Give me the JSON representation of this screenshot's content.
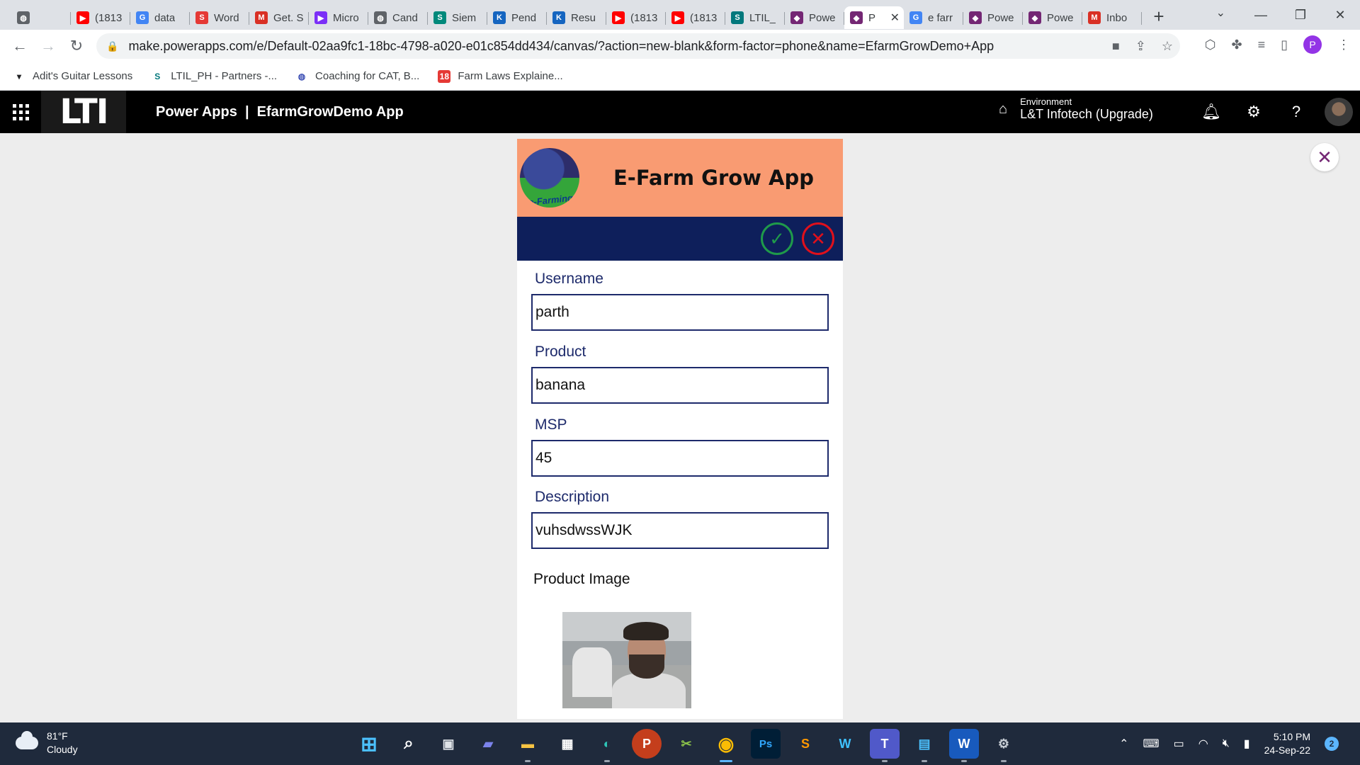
{
  "browser": {
    "tabs": [
      {
        "label": "",
        "icon": "globe-icon",
        "color": "#5f6368"
      },
      {
        "label": "(1813",
        "icon": "youtube-icon",
        "color": "#ff0000"
      },
      {
        "label": "data",
        "icon": "google-icon",
        "color": "#4285f4"
      },
      {
        "label": "Word",
        "icon": "s-logo-icon",
        "color": "#e53935"
      },
      {
        "label": "Get. S",
        "icon": "gmail-icon",
        "color": "#d93025"
      },
      {
        "label": "Micro",
        "icon": "arrow-logo-icon",
        "color": "#7b2ff7"
      },
      {
        "label": "Cand",
        "icon": "globe-icon",
        "color": "#5f6368"
      },
      {
        "label": "Siem",
        "icon": "s-logo-icon",
        "color": "#00897b"
      },
      {
        "label": "Pend",
        "icon": "k-logo-icon",
        "color": "#1565c0"
      },
      {
        "label": "Resu",
        "icon": "k-logo-icon",
        "color": "#1565c0"
      },
      {
        "label": "(1813",
        "icon": "youtube-icon",
        "color": "#ff0000"
      },
      {
        "label": "(1813",
        "icon": "youtube-icon",
        "color": "#ff0000"
      },
      {
        "label": "LTIL_",
        "icon": "sharepoint-icon",
        "color": "#03787c"
      },
      {
        "label": "Powe",
        "icon": "powerapps-icon",
        "color": "#742774"
      },
      {
        "label": "P",
        "icon": "powerapps-icon",
        "color": "#742774",
        "active": true
      },
      {
        "label": "e farr",
        "icon": "google-icon",
        "color": "#4285f4"
      },
      {
        "label": "Powe",
        "icon": "powerapps-icon",
        "color": "#742774"
      },
      {
        "label": "Powe",
        "icon": "powerapps-icon",
        "color": "#742774"
      },
      {
        "label": "Inbo",
        "icon": "gmail-icon",
        "color": "#d93025"
      }
    ],
    "url": "make.powerapps.com/e/Default-02aa9fc1-18bc-4798-a020-e01c854dd434/canvas/?action=new-blank&form-factor=phone&name=EfarmGrowDemo+App",
    "profile_initial": "P",
    "bookmarks": [
      {
        "label": "Adit's Guitar Lessons",
        "icon": "bookmark-icon"
      },
      {
        "label": "LTIL_PH - Partners -...",
        "icon": "sharepoint-icon"
      },
      {
        "label": "Coaching for CAT, B...",
        "icon": "globe-icon"
      },
      {
        "label": "Farm Laws Explaine...",
        "icon": "news18-icon"
      }
    ]
  },
  "powerapps": {
    "logo_text": "LTI",
    "title": "Power Apps  |  EfarmGrowDemo App",
    "environment_label": "Environment",
    "environment_value": "L&T Infotech (Upgrade)"
  },
  "app": {
    "logo_text": "e-Farming",
    "title": "E-Farm Grow App",
    "header_color": "#f99b72",
    "bar_color": "#0e1f5b",
    "fields": [
      {
        "label": "Username",
        "value": "parth"
      },
      {
        "label": "Product",
        "value": "banana"
      },
      {
        "label": "MSP",
        "value": "45"
      },
      {
        "label": "Description",
        "value": "vuhsdwssWJK"
      }
    ],
    "image_label": "Product Image"
  },
  "taskbar": {
    "temperature": "81°F",
    "condition": "Cloudy",
    "time": "5:10 PM",
    "date": "24-Sep-22",
    "notifications": "2"
  }
}
